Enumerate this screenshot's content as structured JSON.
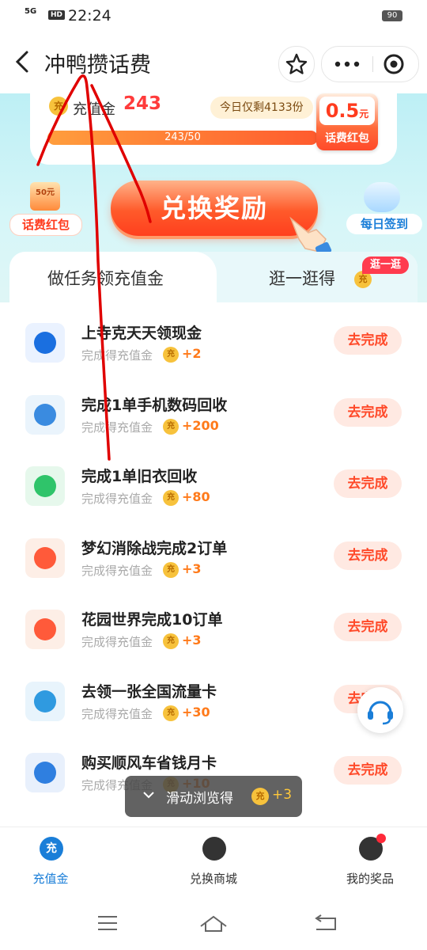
{
  "status_bar": {
    "signal": "5G",
    "hd": "HD",
    "time": "22:24",
    "battery": "90"
  },
  "header": {
    "title": "冲鸭攒话费"
  },
  "balance": {
    "label": "充值金",
    "value": "243",
    "remaining": "今日仅剩4133份",
    "progress_text": "243/50",
    "progress_fraction": 1.0,
    "redpack_amount": "0.5",
    "redpack_unit": "元",
    "redpack_caption": "话费红包"
  },
  "left_badge": {
    "amount": "50元",
    "caption": "话费红包"
  },
  "exchange_button": "兑换奖励",
  "right_badge": {
    "caption": "每日签到"
  },
  "tabs": {
    "active": "做任务领充值金",
    "second": "逛一逛得",
    "second_coin": "充",
    "badge": "逛一逛"
  },
  "tasks": [
    {
      "name": "上寺克天天领现金",
      "sub": "完成得充值金",
      "points": "+2",
      "action": "去完成"
    },
    {
      "name": "完成1单手机数码回收",
      "sub": "完成得充值金",
      "points": "+200",
      "action": "去完成"
    },
    {
      "name": "完成1单旧衣回收",
      "sub": "完成得充值金",
      "points": "+80",
      "action": "去完成"
    },
    {
      "name": "梦幻消除战完成2订单",
      "sub": "完成得充值金",
      "points": "+3",
      "action": "去完成"
    },
    {
      "name": "花园世界完成10订单",
      "sub": "完成得充值金",
      "points": "+3",
      "action": "去完成"
    },
    {
      "name": "去领一张全国流量卡",
      "sub": "完成得充值金",
      "points": "+30",
      "action": "去完成"
    },
    {
      "name": "购买顺风车省钱月卡",
      "sub": "完成得充值金",
      "points": "+10",
      "action": "去完成"
    }
  ],
  "coin_glyph": "充",
  "toast": {
    "label": "滑动浏览得",
    "points": "+3"
  },
  "bottom_nav": [
    {
      "label": "充值金"
    },
    {
      "label": "兑换商城"
    },
    {
      "label": "我的奖品"
    }
  ],
  "colors": {
    "accent_blue": "#1a7ed8",
    "accent_red": "#ff3b1e",
    "coin": "#f7c23c"
  }
}
